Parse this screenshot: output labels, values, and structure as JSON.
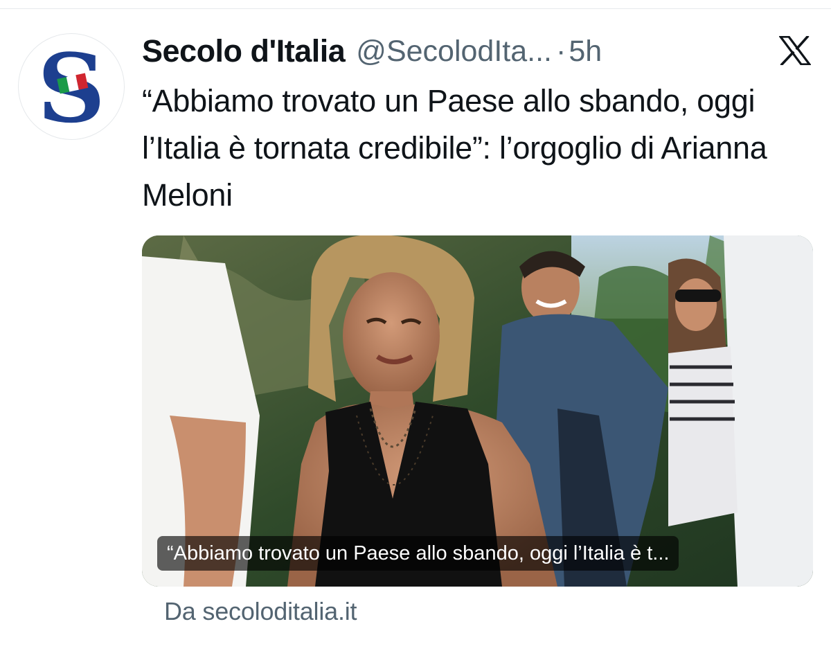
{
  "account": {
    "display_name": "Secolo d'Italia",
    "handle": "@SecolodIta...",
    "separator": "·",
    "time": "5h",
    "avatar_letter": "S",
    "avatar_icon": "secolo-ditalia-logo"
  },
  "platform_icon": "x-logo-icon",
  "tweet": {
    "text": "“Abbiamo trovato un Paese allo sbando, oggi l’Italia è tornata credibile”: l’orgoglio di Arianna Meloni"
  },
  "card": {
    "image_subject": "photo",
    "caption": "“Abbiamo trovato un Paese allo sbando, oggi l’Italia è t...",
    "source": "Da secoloditalia.it"
  },
  "colors": {
    "text_primary": "#0f1419",
    "text_secondary": "#536471",
    "logo_blue": "#1d3f8f",
    "flag_green": "#1a9a49",
    "flag_red": "#d1262f"
  }
}
